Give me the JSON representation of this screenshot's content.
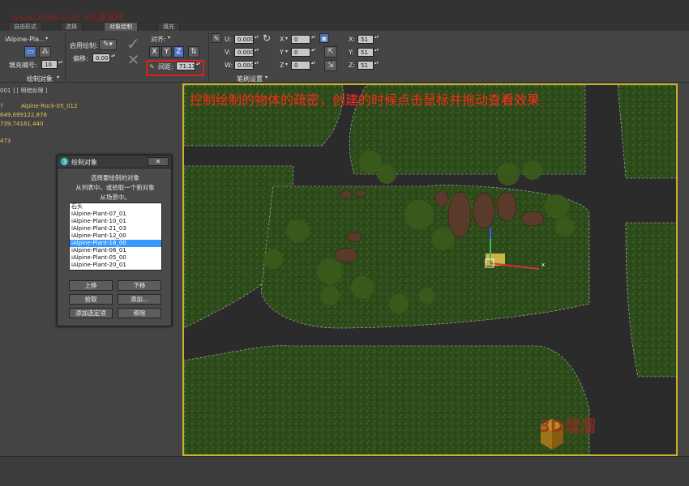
{
  "watermark_top": "www.3d66.com 3D溜溜网",
  "tabs": [
    {
      "label": "自由形式"
    },
    {
      "label": "选择"
    },
    {
      "label": "对象绘制"
    },
    {
      "label": "填充"
    }
  ],
  "ribbon": {
    "paint_object_name": "iAlpine-Pla...",
    "fill_number_label": "填充编号:",
    "fill_number_value": "10",
    "paint_object_panel": "绘制对象",
    "enable_paint_label": "启用绘制:",
    "offset_label": "偏移:",
    "offset_value": "0.00",
    "align_label": "对齐:",
    "spacing_label": "间距:",
    "spacing_value": "71.11",
    "u_label": "U:",
    "u_value": "0.000",
    "v_label": "V:",
    "v_value": "0.000",
    "w_label": "W:",
    "w_value": "0.000",
    "x_rot_label": "X",
    "x_rot_value": "0",
    "y_rot_label": "Y",
    "y_rot_value": "0",
    "z_rot_label": "Z",
    "z_rot_value": "0",
    "x_scale_label": "X:",
    "x_scale_value": "51",
    "y_scale_label": "Y:",
    "y_scale_value": "51",
    "z_scale_label": "Z:",
    "z_scale_value": "51",
    "brush_settings_panel": "笔刷设置",
    "axis_x": "X",
    "axis_y": "Y",
    "axis_z": "Z"
  },
  "left_info": {
    "header": "001 ] [ 明暗处理 ]",
    "object_name": "Alpine-Rock-05_012",
    "line1": "649,699122,876",
    "line2": "739,74161,440",
    "line3": "473",
    "mark": "f"
  },
  "viewport": {
    "annotation": "控制绘制的物体的疏密，创建的时候点击鼠标并拖动查看效果",
    "logo_watermark": "3D溜溜",
    "gizmo_x": "x",
    "colors": {
      "grass": "#2d4a1a",
      "road": "#2b2b2b",
      "border": "#c8b22a"
    }
  },
  "dialog": {
    "title": "绘制对象",
    "close": "✕",
    "message_lines": [
      "选择要绘制的对象",
      "从列表中，或拾取一个新对象",
      "从场景中。"
    ],
    "list_items": [
      "石头",
      "iAlpine-Plant-07_01",
      "iAlpine-Plant-10_01",
      "iAlpine-Plant-21_03",
      "iAlpine-Plant-12_00",
      "iAlpine-Plant-16_00",
      "iAlpine-Plant-06_01",
      "iAlpine-Plant-05_00",
      "iAlpine-Plant-20_01"
    ],
    "selected_index": 5,
    "buttons": {
      "move_up": "上移",
      "move_down": "下移",
      "pick": "拾取",
      "add": "添加...",
      "add_selected": "添加选定项",
      "remove": "移除"
    }
  }
}
